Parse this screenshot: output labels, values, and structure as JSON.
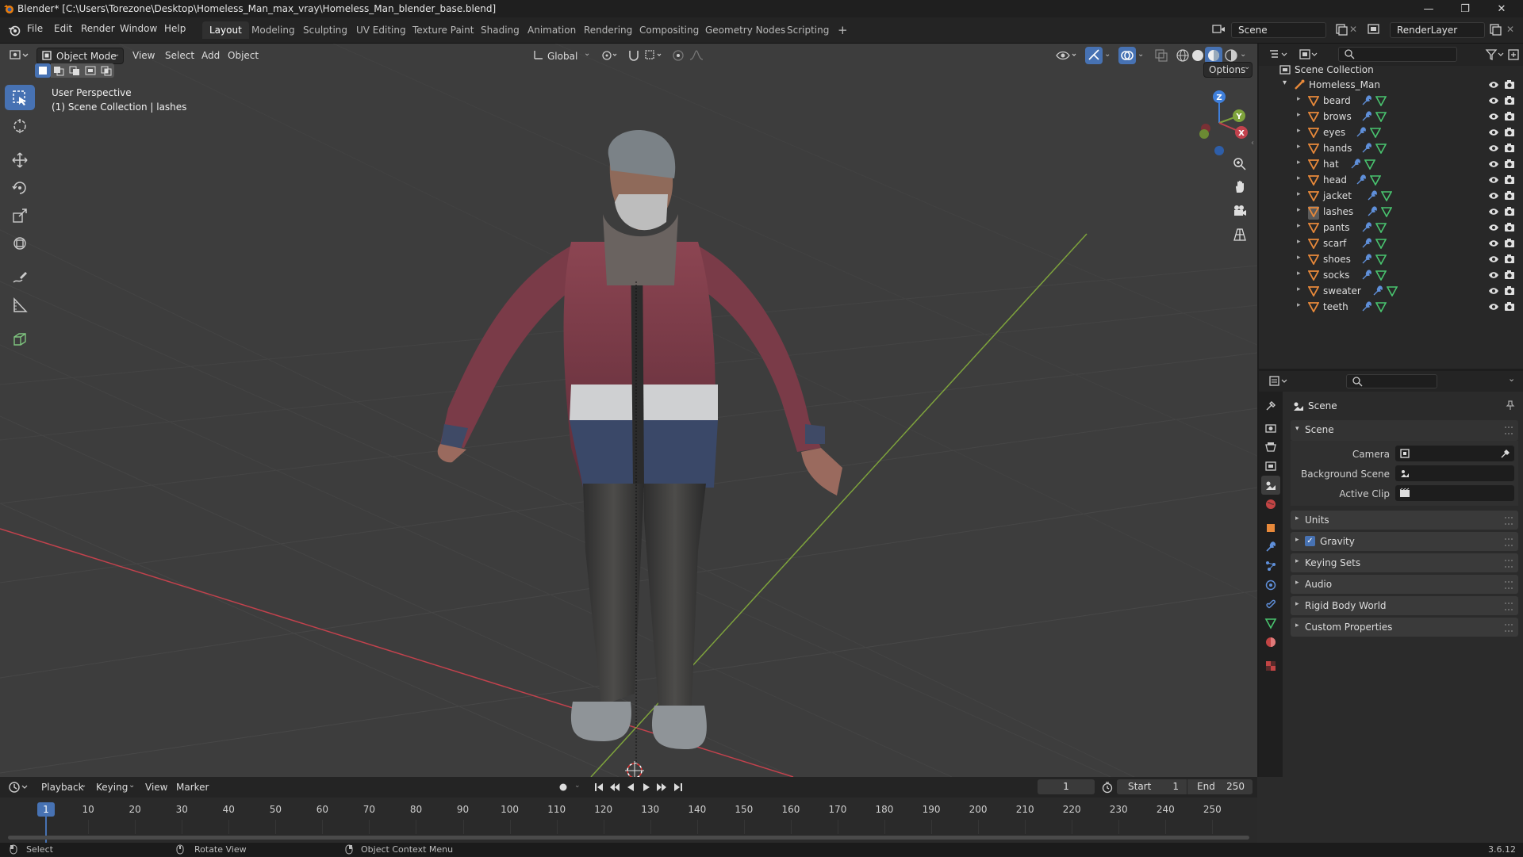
{
  "window": {
    "title": "Blender* [C:\\Users\\Torezone\\Desktop\\Homeless_Man_max_vray\\Homeless_Man_blender_base.blend]",
    "minimize": "—",
    "maximize": "❐",
    "close": "✕"
  },
  "menu": {
    "file": "File",
    "edit": "Edit",
    "render": "Render",
    "window": "Window",
    "help": "Help"
  },
  "workspaces": [
    "Layout",
    "Modeling",
    "Sculpting",
    "UV Editing",
    "Texture Paint",
    "Shading",
    "Animation",
    "Rendering",
    "Compositing",
    "Geometry Nodes",
    "Scripting"
  ],
  "workspace_add": "+",
  "scene_selector": {
    "value": "Scene"
  },
  "view_layer_selector": {
    "value": "RenderLayer"
  },
  "viewport": {
    "mode": "Object Mode",
    "view_menu": "View",
    "select_menu": "Select",
    "add_menu": "Add",
    "object_menu": "Object",
    "orientation": "Global",
    "options": "Options",
    "overlay_title": "User Perspective",
    "overlay_subtitle": "(1) Scene Collection | lashes",
    "gizmo": {
      "x": "X",
      "y": "Y",
      "z": "Z"
    }
  },
  "outliner": {
    "root": "Scene Collection",
    "object": "Homeless_Man",
    "children": [
      "beard",
      "brows",
      "eyes",
      "hands",
      "hat",
      "head",
      "jacket",
      "lashes",
      "pants",
      "scarf",
      "shoes",
      "socks",
      "sweater",
      "teeth"
    ],
    "active_child": "lashes"
  },
  "properties": {
    "header": "Scene",
    "scene_panel": "Scene",
    "camera_label": "Camera",
    "background_scene_label": "Background Scene",
    "active_clip_label": "Active Clip",
    "panels": [
      "Units",
      "Gravity",
      "Keying Sets",
      "Audio",
      "Rigid Body World",
      "Custom Properties"
    ],
    "gravity_checked": true
  },
  "timeline": {
    "playback": "Playback",
    "keying": "Keying",
    "view": "View",
    "marker": "Marker",
    "current_frame": "1",
    "start_label": "Start",
    "start_value": "1",
    "end_label": "End",
    "end_value": "250",
    "ticks": [
      "10",
      "20",
      "30",
      "40",
      "50",
      "60",
      "70",
      "80",
      "90",
      "100",
      "110",
      "120",
      "130",
      "140",
      "150",
      "160",
      "170",
      "180",
      "190",
      "200",
      "210",
      "220",
      "230",
      "240",
      "250"
    ],
    "playhead_label": "1"
  },
  "statusbar": {
    "select": "Select",
    "rotate": "Rotate View",
    "context": "Object Context Menu",
    "version": "3.6.12"
  },
  "colors": {
    "accent": "#4772b3",
    "axis_x": "#c2424d",
    "axis_y": "#7ea33c",
    "axis_z": "#3f7fdb",
    "mesh_icon": "#e8893a",
    "modifier_icon": "#5f8fd9",
    "data_icon": "#49c46f"
  }
}
